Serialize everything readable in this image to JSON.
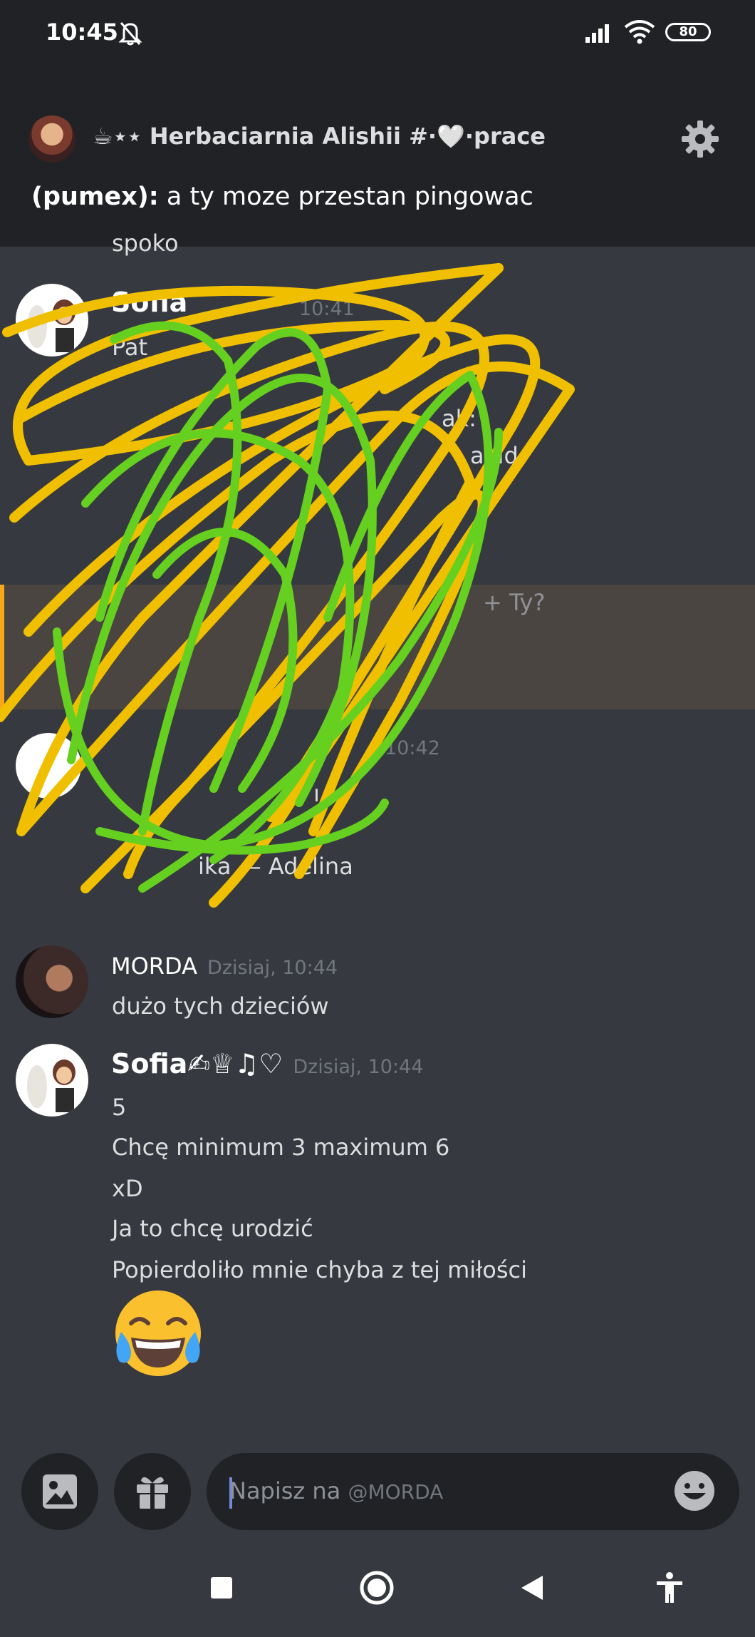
{
  "status_bar": {
    "time": "10:45",
    "battery": "80"
  },
  "header": {
    "channel_title": "☕⋆⋆ Herbaciarnia Alishii #·🤍·prace",
    "preview_author": "(pumex):",
    "preview_text": " a ty moze przestan pingowac"
  },
  "messages": {
    "cut_top": "spoko",
    "m1": {
      "author": "Sofia",
      "timestamp": "10:41",
      "line1": "Pat",
      "line2": "ak:",
      "line3": "avid"
    },
    "reply_snippet": "+ Ty?",
    "m2": {
      "timestamp": "10:42",
      "line1": "ı",
      "line2": "ika — Adelina"
    },
    "m3": {
      "author": "MORDA",
      "timestamp": "Dzisiaj, 10:44",
      "text": "dużo tych dzieciów"
    },
    "m4": {
      "author": "Sofia✍︎♕♫♡",
      "timestamp": "Dzisiaj, 10:44",
      "lines": [
        "5",
        "Chcę minimum 3 maximum 6",
        "xD",
        "Ja to chcę urodzić",
        "Popierdoliło mnie chyba z tej miłości"
      ]
    }
  },
  "composer": {
    "placeholder": "Napisz na",
    "mention": "@MORDA"
  },
  "icons": {
    "bell": "bell-off-icon",
    "gear": "gear-icon",
    "image": "image-icon",
    "gift": "gift-icon",
    "emoji": "emoji-icon"
  }
}
